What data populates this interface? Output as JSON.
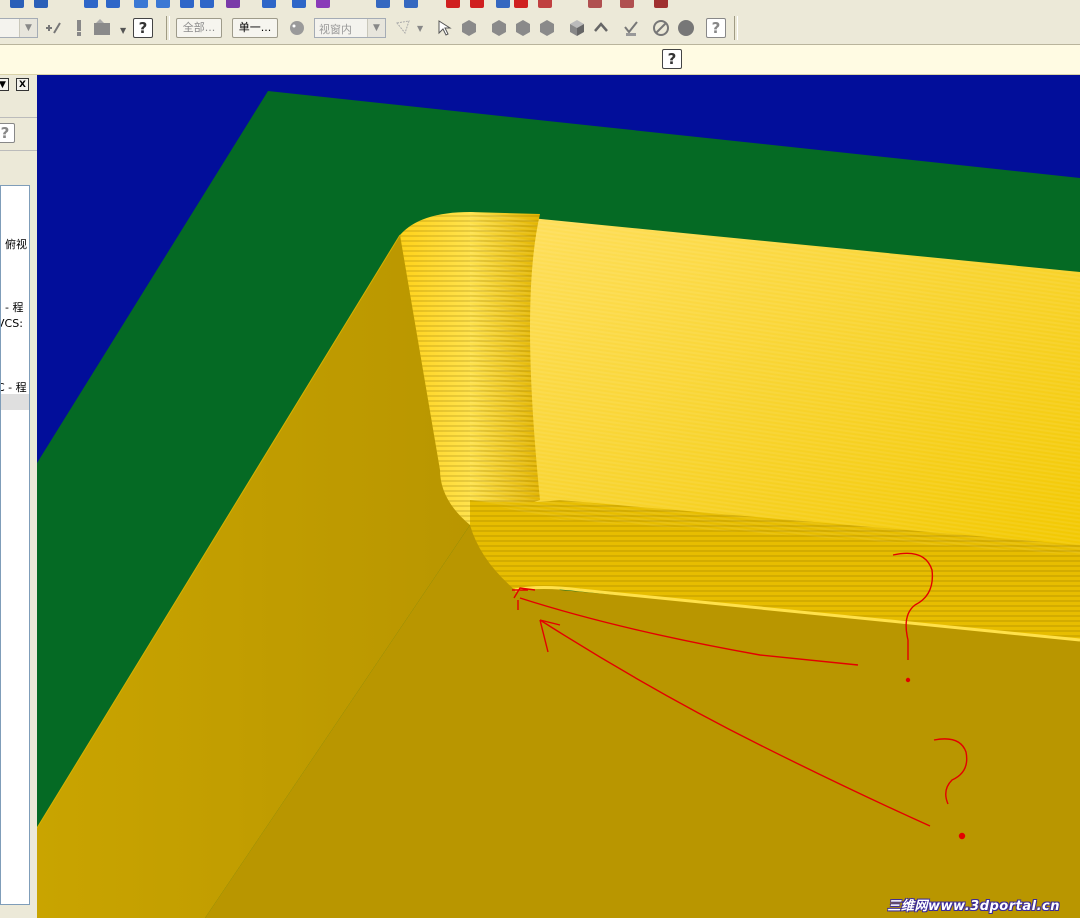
{
  "toolbar": {
    "all_button": "全部...",
    "single_button": "单一...",
    "view_combo": "视窗内",
    "help_label": "?"
  },
  "infobar": {
    "help_label": "?"
  },
  "left_panel": {
    "close_label": "X",
    "help_label": "?",
    "items": [
      "俯视",
      "- 程",
      "VCS:",
      "C - 程"
    ]
  },
  "viewport": {
    "background_color": "#020e9a",
    "plane_color": "#056a24",
    "part_color": "#b89a00",
    "highlight_color": "#ffd800"
  },
  "watermark": {
    "text": "三维网www.3dportal.cn"
  }
}
